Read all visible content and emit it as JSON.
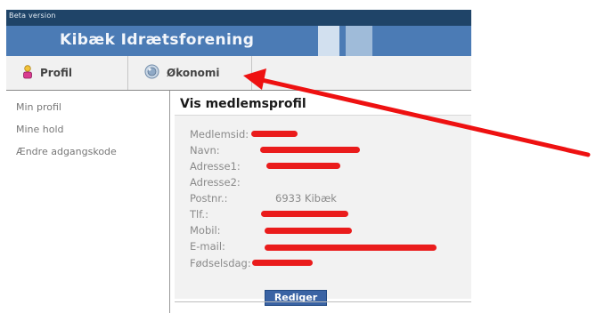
{
  "app": {
    "beta_label": "Beta version",
    "title": "Kibæk Idrætsforening"
  },
  "nav": {
    "profil": "Profil",
    "okonomi": "Økonomi"
  },
  "sidebar": {
    "items": [
      {
        "label": "Min profil"
      },
      {
        "label": "Mine hold"
      },
      {
        "label": "Ændre adgangskode"
      }
    ]
  },
  "panel": {
    "title": "Vis medlemsprofil",
    "fields": [
      {
        "label": "Medlemsid:",
        "value": ""
      },
      {
        "label": "Navn:",
        "value": ""
      },
      {
        "label": "Adresse1:",
        "value": ""
      },
      {
        "label": "Adresse2:",
        "value": ""
      },
      {
        "label": "Postnr.:",
        "value": "6933 Kibæk"
      },
      {
        "label": "Tlf.:",
        "value": ""
      },
      {
        "label": "Mobil:",
        "value": ""
      },
      {
        "label": "E-mail:",
        "value": ""
      },
      {
        "label": "Fødselsdag:",
        "value": ""
      }
    ],
    "edit_button": "Rediger"
  },
  "colors": {
    "topbar": "#1f4468",
    "banner": "#4b7bb5",
    "redaction": "#ea1c1c",
    "arrow": "#ee1111",
    "button": "#3a63a4"
  },
  "icons": {
    "profil": "person-icon",
    "okonomi": "coin-icon"
  }
}
